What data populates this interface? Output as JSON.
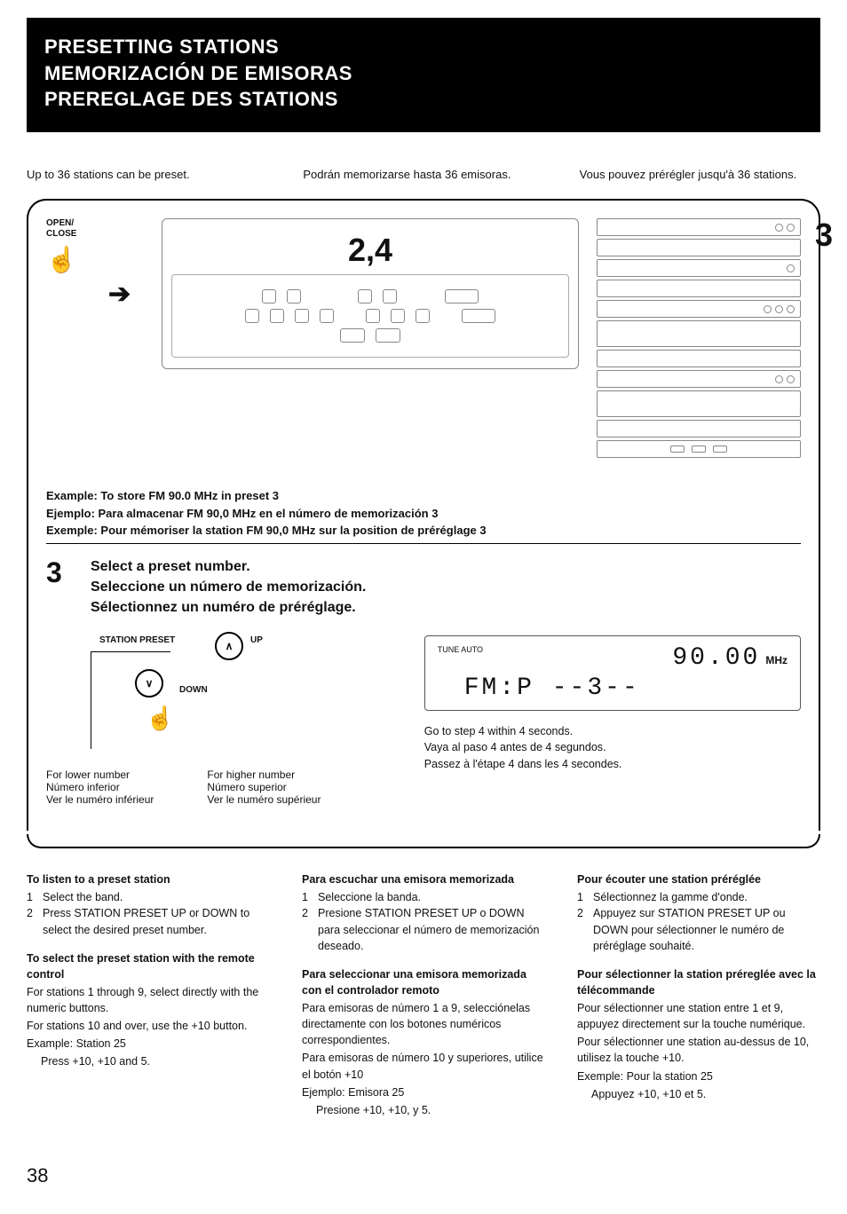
{
  "header": {
    "title_en": "PRESETTING STATIONS",
    "title_es": "MEMORIZACIÓN DE EMISORAS",
    "title_fr": "PREREGLAGE DES STATIONS"
  },
  "intro": {
    "en": "Up to 36 stations can be preset.",
    "es": "Podrán memorizarse hasta 36 emisoras.",
    "fr": "Vous pouvez prérégler jusqu'à 36 stations."
  },
  "diagram": {
    "steps24": "2,4",
    "step3_callout": "3",
    "open_close": "OPEN/\nCLOSE"
  },
  "example": {
    "en": "Example: To store FM 90.0 MHz in preset 3",
    "es": "Ejemplo: Para almacenar FM 90,0 MHz en el número de memorización 3",
    "fr": "Exemple: Pour mémoriser la station FM 90,0 MHz sur la position de préréglage 3"
  },
  "step3": {
    "num": "3",
    "en": "Select a preset number.",
    "es": "Seleccione un número de memorización.",
    "fr": "Sélectionnez un numéro de préréglage."
  },
  "preset_dia": {
    "station_preset": "STATION PRESET",
    "up": "UP",
    "down": "DOWN",
    "lower_en": "For lower number",
    "lower_es": "Número inferior",
    "lower_fr": "Ver le numéro inférieur",
    "higher_en": "For higher number",
    "higher_es": "Número superior",
    "higher_fr": "Ver le numéro supérieur"
  },
  "lcd": {
    "tune_auto": "TUNE AUTO",
    "freq": "90.00",
    "unit": "MHz",
    "line2": "FM:P   --3--",
    "note_en": "Go to step 4 within 4 seconds.",
    "note_es": "Vaya al paso 4 antes de 4 segundos.",
    "note_fr": "Passez à l'étape 4 dans les 4 secondes."
  },
  "cols": {
    "en": {
      "h1": "To listen to a preset station",
      "l1": "Select the band.",
      "l2": "Press STATION PRESET UP or DOWN to select the desired preset number.",
      "h2": "To select the preset station with the remote control",
      "p1": "For stations 1 through 9, select directly with the numeric buttons.",
      "p2": "For stations 10 and over, use the +10 button.",
      "p3": "Example: Station 25",
      "p4": "Press +10, +10 and 5."
    },
    "es": {
      "h1": "Para escuchar una emisora memorizada",
      "l1": "Seleccione la banda.",
      "l2": "Presione STATION PRESET UP o DOWN para seleccionar el número de memorización deseado.",
      "h2": "Para seleccionar una emisora memorizada con el controlador remoto",
      "p1": "Para emisoras de número 1 a 9, selecciónelas directamente con los botones numéricos correspondientes.",
      "p2": "Para emisoras de número 10 y superiores, utilice el botón +10",
      "p3": "Ejemplo: Emisora 25",
      "p4": "Presione +10, +10, y 5."
    },
    "fr": {
      "h1": "Pour écouter une station préréglée",
      "l1": "Sélectionnez la gamme d'onde.",
      "l2": "Appuyez sur STATION PRESET UP ou DOWN pour sélectionner le numéro de préréglage souhaité.",
      "h2": "Pour sélectionner la station préreglée avec la télécommande",
      "p1": "Pour sélectionner une station entre 1 et 9, appuyez directement sur la touche numérique.",
      "p2": "Pour sélectionner une station au-dessus de 10, utilisez la touche +10.",
      "p3": "Exemple: Pour la station 25",
      "p4": "Appuyez +10, +10 et 5."
    }
  },
  "page_number": "38"
}
